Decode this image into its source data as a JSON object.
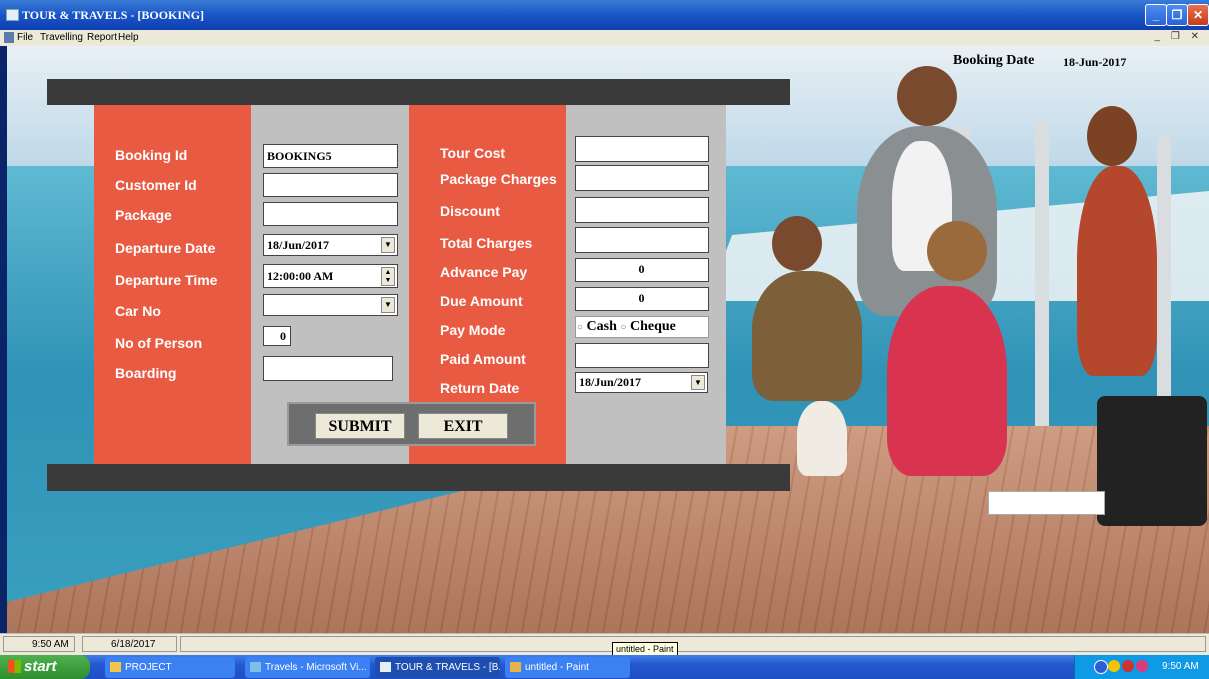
{
  "window": {
    "title": "TOUR & TRAVELS - [BOOKING]",
    "caption_buttons": [
      "_",
      "❐",
      "✕"
    ],
    "mdi_controls": "_ ❐ ✕"
  },
  "menu": [
    "File",
    "Travelling",
    "Report",
    "Help"
  ],
  "booking_date": {
    "label": "Booking Date",
    "value": "18-Jun-2017"
  },
  "form": {
    "left_labels": {
      "booking_id": "Booking Id",
      "customer_id": "Customer Id",
      "package": "Package",
      "departure_date": "Departure Date",
      "departure_time": "Departure Time",
      "car_no": "Car No",
      "no_of_person": "No of Person",
      "boarding": "Boarding"
    },
    "left_values": {
      "booking_id": "BOOKING5",
      "customer_id": "",
      "package": "",
      "departure_date": "18/Jun/2017",
      "departure_time": "12:00:00 AM",
      "car_no": "",
      "no_of_person": "0",
      "boarding": ""
    },
    "right_labels": {
      "tour_cost": "Tour Cost",
      "package_charges": "Package Charges",
      "discount": "Discount",
      "total_charges": "Total Charges",
      "advance_pay": "Advance Pay",
      "due_amount": "Due Amount",
      "pay_mode": "Pay Mode",
      "paid_amount": "Paid Amount",
      "return_date": "Return Date"
    },
    "right_values": {
      "tour_cost": "",
      "package_charges": "",
      "discount": "",
      "total_charges": "",
      "advance_pay": "0",
      "due_amount": "0",
      "paid_amount": "",
      "return_date": "18/Jun/2017"
    },
    "pay_mode_options": {
      "cash": "Cash",
      "cheque": "Cheque"
    },
    "buttons": {
      "submit": "SUBMIT",
      "exit": "EXIT"
    }
  },
  "statusbar": {
    "time": "9:50 AM",
    "date": "6/18/2017"
  },
  "tooltip": "untitled - Paint",
  "taskbar": {
    "start": "start",
    "tasks": [
      "PROJECT",
      "Travels - Microsoft Vi...",
      "TOUR & TRAVELS - [B...",
      "untitled - Paint"
    ],
    "clock": "9:50 AM"
  },
  "colors": {
    "form_red": "#e95a42",
    "form_gray": "#c0c0c0",
    "strip": "#3a3a3a",
    "titlebar": "#1a55c8"
  }
}
